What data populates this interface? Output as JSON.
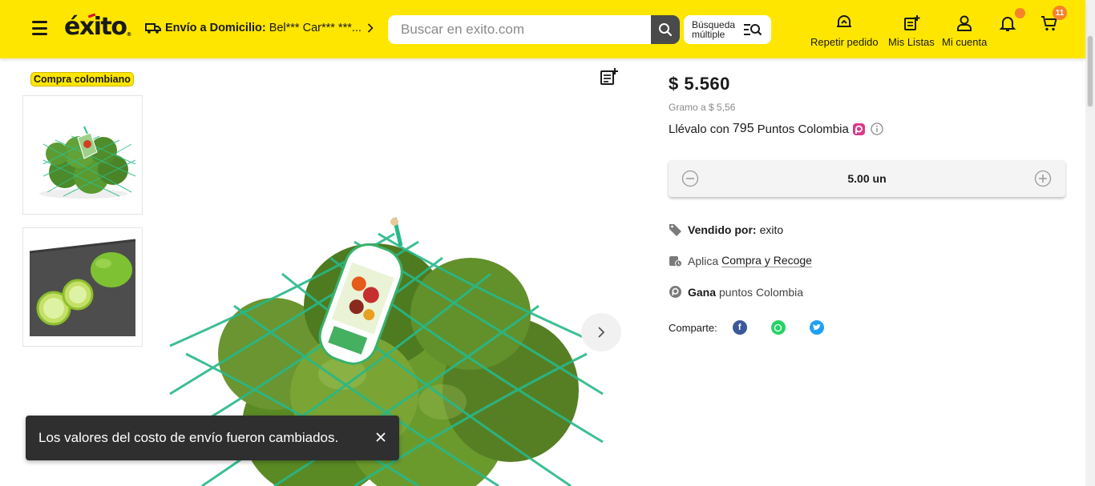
{
  "header": {
    "logo": "éxito",
    "delivery_label": "Envío a Domicilio:",
    "delivery_address": "Bel*** Car*** ***...",
    "search_placeholder": "Buscar en exito.com",
    "multi_search_label": "Búsqueda múltiple",
    "repeat_order": "Repetir pedido",
    "my_lists": "Mis Listas",
    "my_account": "Mi cuenta",
    "cart_count": "11",
    "accent_color": "#ffe600",
    "badge_color": "#f5822a"
  },
  "product": {
    "origin_badge": "Compra colombiano",
    "price": "$ 5.560",
    "unit_price": "Gramo a $ 5,56",
    "points_prefix": "Llévalo con",
    "points_value": "795",
    "points_suffix": "Puntos Colombia",
    "quantity": "5.00 un",
    "sold_by_label": "Vendido por:",
    "sold_by_value": "exito",
    "pickup_prefix": "Aplica",
    "pickup_link": "Compra y Recoge",
    "earn_label": "Gana",
    "earn_value": "puntos Colombia",
    "share_label": "Comparte:"
  },
  "toast": {
    "message": "Los valores del costo de envío fueron cambiados."
  },
  "icons": {
    "menu": "hamburger-icon",
    "truck": "truck-icon",
    "search": "search-icon",
    "multi_search": "list-search-icon",
    "repeat": "repeat-order-icon",
    "lists": "list-add-icon",
    "account": "user-icon",
    "bell": "bell-icon",
    "cart": "cart-icon"
  }
}
